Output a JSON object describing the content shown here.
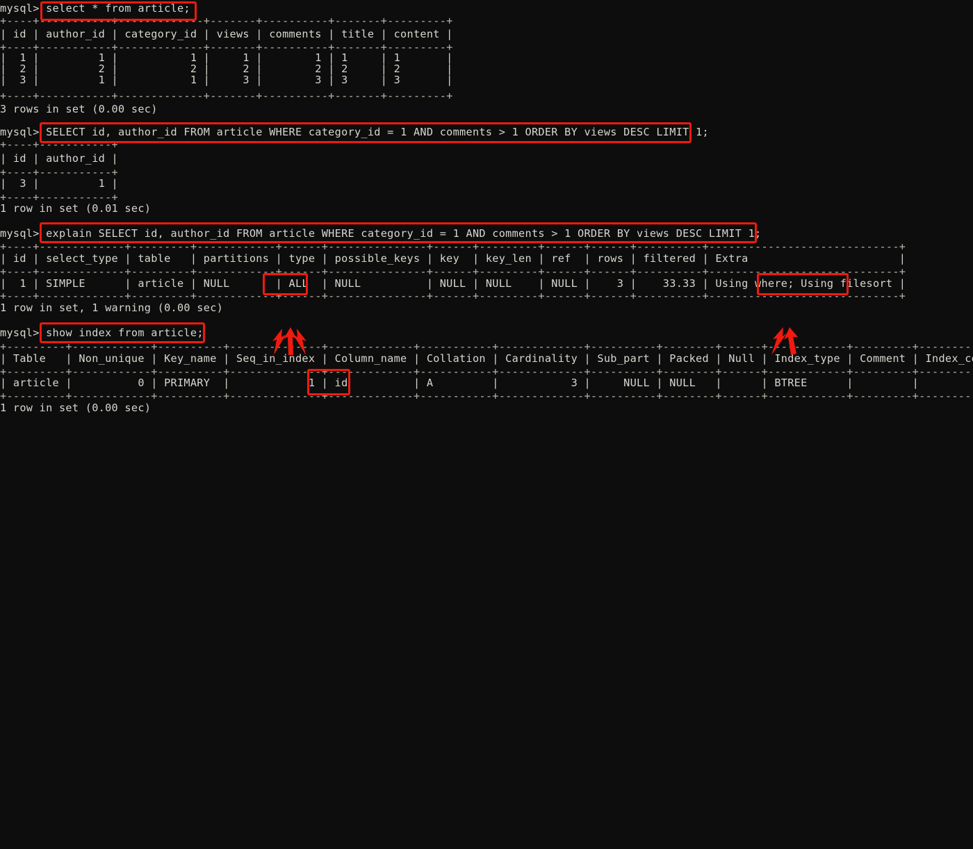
{
  "terminal": {
    "prompt": "mysql>",
    "background_color": "#0d0d0d",
    "text_color": "#d8d6cf",
    "highlight_color": "#f01a0f"
  },
  "commands": {
    "cmd1": "select * from article;",
    "cmd2": "SELECT id, author_id FROM article WHERE category_id = 1 AND comments > 1 ORDER BY views DESC LIMIT 1;",
    "cmd3": "explain SELECT id, author_id FROM article WHERE category_id = 1 AND comments > 1 ORDER BY views DESC LIMIT 1;",
    "cmd4": "show index from article;"
  },
  "block1": {
    "prompt_line": "mysql> ",
    "rule_top": "+----+-----------+-------------+-------+----------+-------+---------+",
    "header": "| id | author_id | category_id | views | comments | title | content |",
    "rule_mid": "+----+-----------+-------------+-------+----------+-------+---------+",
    "row1": "|  1 |         1 |           1 |     1 |        1 | 1     | 1       |",
    "row2": "|  2 |         2 |           2 |     2 |        2 | 2     | 2       |",
    "row3": "|  3 |         1 |           1 |     3 |        3 | 3     | 3       |",
    "rule_bot": "+----+-----------+-------------+-------+----------+-------+---------+",
    "status": "3 rows in set (0.00 sec)"
  },
  "block2": {
    "rule_top": "+----+-----------+",
    "header": "| id | author_id |",
    "rule_mid": "+----+-----------+",
    "row1": "|  3 |         1 |",
    "rule_bot": "+----+-----------+",
    "status": "1 row in set (0.01 sec)"
  },
  "block3": {
    "rule_top": "+----+-------------+---------+------------+------+---------------+------+---------+------+------+----------+-----------------------------+",
    "header": "| id | select_type | table   | partitions | type | possible_keys | key  | key_len | ref  | rows | filtered | Extra                       |",
    "rule_mid": "+----+-------------+---------+------------+------+---------------+------+---------+------+------+----------+-----------------------------+",
    "row1": "|  1 | SIMPLE      | article | NULL       | ALL  | NULL          | NULL | NULL    | NULL |    3 |    33.33 | Using where; Using filesort |",
    "rule_bot": "+----+-------------+---------+------------+------+---------------+------+---------+------+------+----------+-----------------------------+",
    "status": "1 row in set, 1 warning (0.00 sec)"
  },
  "block4": {
    "rule_top": "+---------+------------+----------+--------------+-------------+-----------+-------------+----------+--------+------+------------+---------+---------------+",
    "header": "| Table   | Non_unique | Key_name | Seq_in_index | Column_name | Collation | Cardinality | Sub_part | Packed | Null | Index_type | Comment | Index_comment |",
    "rule_mid": "+---------+------------+----------+--------------+-------------+-----------+-------------+----------+--------+------+------------+---------+---------------+",
    "row1": "| article |          0 | PRIMARY  |            1 | id          | A         |           3 |     NULL | NULL   |      | BTREE      |         |               |",
    "rule_bot": "+---------+------------+----------+--------------+-------------+-----------+-------------+----------+--------+------+------------+---------+---------------+",
    "status": "1 row in set (0.00 sec)"
  },
  "annotations": {
    "highlight_cmd1": "select * from article;",
    "highlight_cmd2": "SELECT id, author_id FROM article WHERE category_id = 1 AND comments > 1 ORDER BY views DESC LIMIT 1;",
    "highlight_cmd3": "explain SELECT id, author_id FROM article WHERE category_id = 1 AND comments > 1 ORDER BY views DESC LIMIT 1;",
    "highlight_cmd4": "show index from article;",
    "highlight_type_all": "ALL",
    "highlight_extra_filesort": "Using filesort",
    "highlight_column_name_id": "id",
    "arrow_count_all": 3,
    "arrow_count_filesort": 2
  }
}
